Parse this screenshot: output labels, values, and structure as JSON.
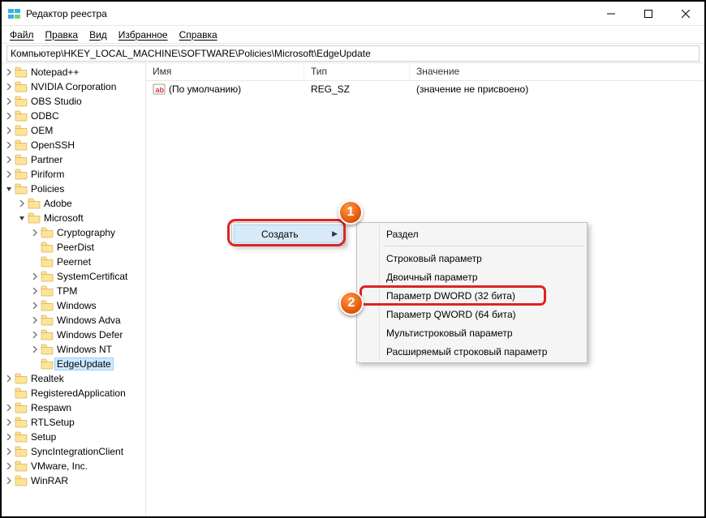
{
  "window": {
    "title": "Редактор реестра"
  },
  "menubar": {
    "items": [
      "Файл",
      "Правка",
      "Вид",
      "Избранное",
      "Справка"
    ]
  },
  "address": "Компьютер\\HKEY_LOCAL_MACHINE\\SOFTWARE\\Policies\\Microsoft\\EdgeUpdate",
  "tree": [
    {
      "label": "Notepad++",
      "depth": 0,
      "expander": ">"
    },
    {
      "label": "NVIDIA Corporation",
      "depth": 0,
      "expander": ">"
    },
    {
      "label": "OBS Studio",
      "depth": 0,
      "expander": ">"
    },
    {
      "label": "ODBC",
      "depth": 0,
      "expander": ">"
    },
    {
      "label": "OEM",
      "depth": 0,
      "expander": ">"
    },
    {
      "label": "OpenSSH",
      "depth": 0,
      "expander": ">"
    },
    {
      "label": "Partner",
      "depth": 0,
      "expander": ">"
    },
    {
      "label": "Piriform",
      "depth": 0,
      "expander": ">"
    },
    {
      "label": "Policies",
      "depth": 0,
      "expander": "v"
    },
    {
      "label": "Adobe",
      "depth": 1,
      "expander": ">"
    },
    {
      "label": "Microsoft",
      "depth": 1,
      "expander": "v"
    },
    {
      "label": "Cryptography",
      "depth": 2,
      "expander": ">"
    },
    {
      "label": "PeerDist",
      "depth": 2,
      "expander": ""
    },
    {
      "label": "Peernet",
      "depth": 2,
      "expander": ""
    },
    {
      "label": "SystemCertificat",
      "depth": 2,
      "expander": ">"
    },
    {
      "label": "TPM",
      "depth": 2,
      "expander": ">"
    },
    {
      "label": "Windows",
      "depth": 2,
      "expander": ">"
    },
    {
      "label": "Windows Adva",
      "depth": 2,
      "expander": ">"
    },
    {
      "label": "Windows Defer",
      "depth": 2,
      "expander": ">"
    },
    {
      "label": "Windows NT",
      "depth": 2,
      "expander": ">"
    },
    {
      "label": "EdgeUpdate",
      "depth": 2,
      "expander": "",
      "selected": true
    },
    {
      "label": "Realtek",
      "depth": 0,
      "expander": ">"
    },
    {
      "label": "RegisteredApplication",
      "depth": 0,
      "expander": ""
    },
    {
      "label": "Respawn",
      "depth": 0,
      "expander": ">"
    },
    {
      "label": "RTLSetup",
      "depth": 0,
      "expander": ">"
    },
    {
      "label": "Setup",
      "depth": 0,
      "expander": ">"
    },
    {
      "label": "SyncIntegrationClient",
      "depth": 0,
      "expander": ">"
    },
    {
      "label": "VMware, Inc.",
      "depth": 0,
      "expander": ">"
    },
    {
      "label": "WinRAR",
      "depth": 0,
      "expander": ">"
    }
  ],
  "list": {
    "headers": {
      "name": "Имя",
      "type": "Тип",
      "value": "Значение"
    },
    "rows": [
      {
        "name": "(По умолчанию)",
        "type": "REG_SZ",
        "value": "(значение не присвоено)"
      }
    ]
  },
  "context_menu1": {
    "create": "Создать"
  },
  "context_menu2": {
    "items": [
      {
        "label": "Раздел"
      },
      {
        "sep": true
      },
      {
        "label": "Строковый параметр"
      },
      {
        "label": "Двоичный параметр"
      },
      {
        "label": "Параметр DWORD (32 бита)",
        "hl": true
      },
      {
        "label": "Параметр QWORD (64 бита)"
      },
      {
        "label": "Мультистроковый параметр"
      },
      {
        "label": "Расширяемый строковый параметр"
      }
    ]
  },
  "badges": {
    "1": "1",
    "2": "2"
  }
}
